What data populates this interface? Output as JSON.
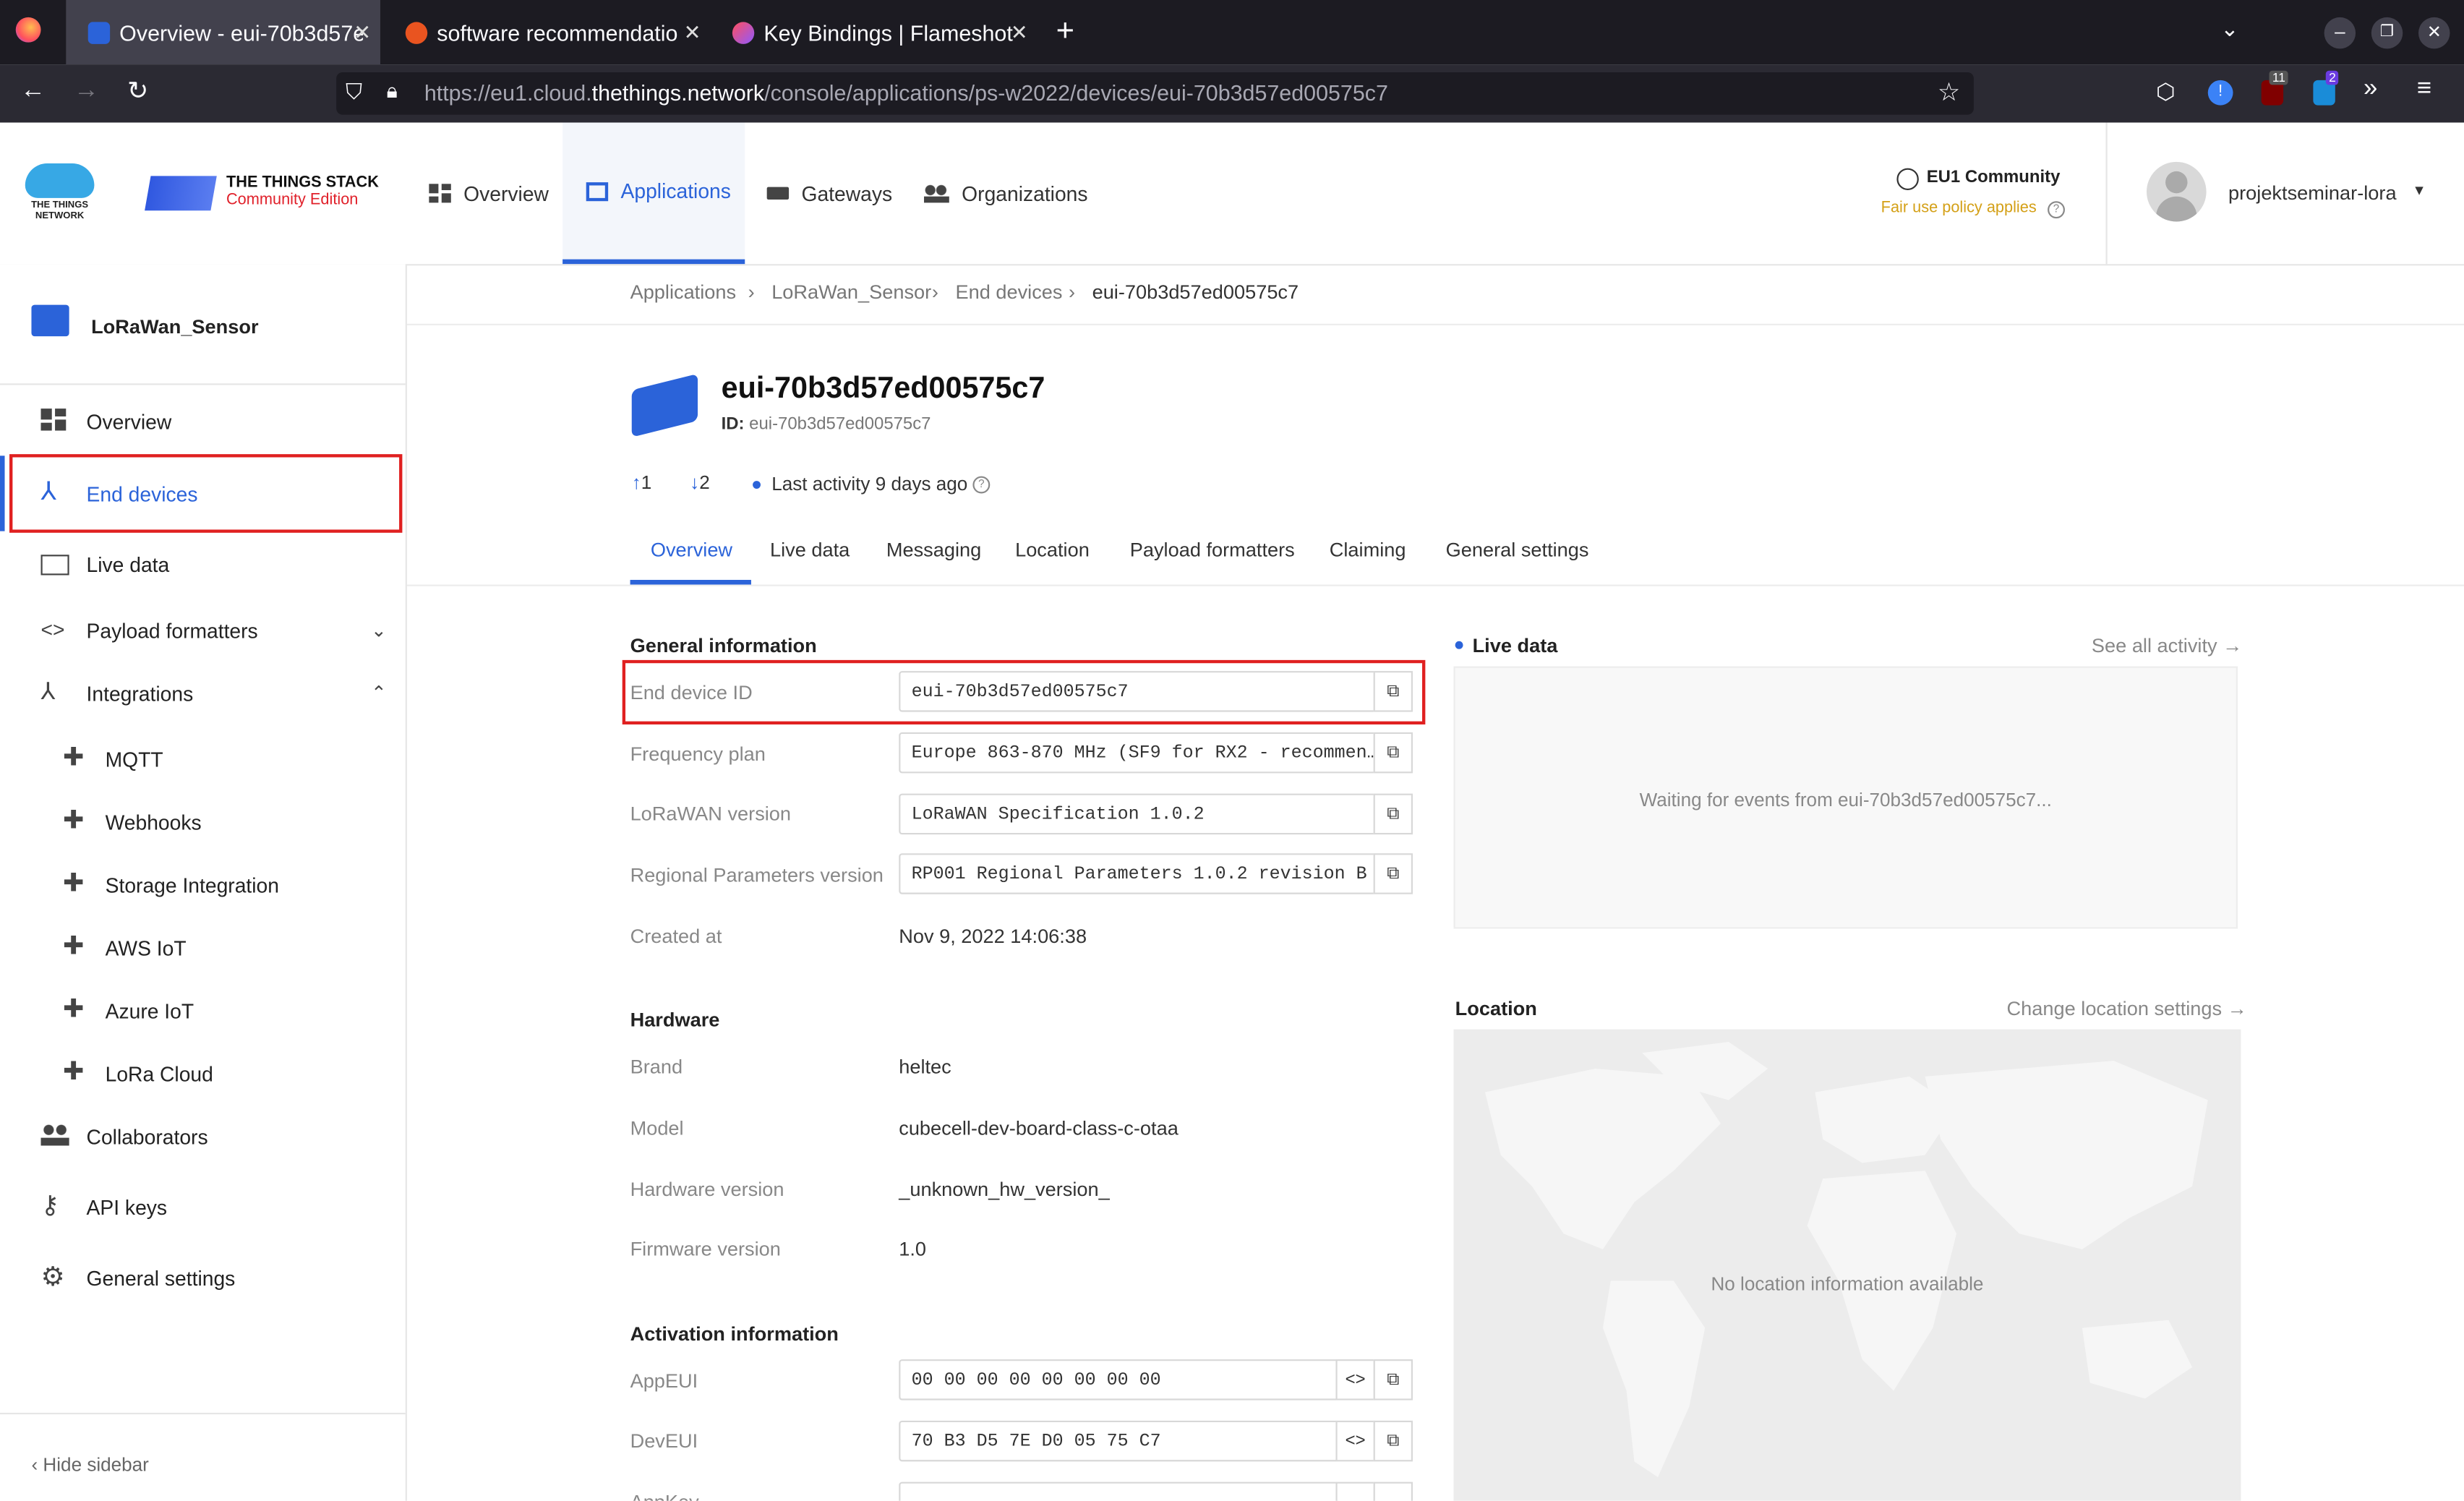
{
  "browser": {
    "tabs": [
      {
        "label": "Overview - eui-70b3d57e"
      },
      {
        "label": "software recommendatio"
      },
      {
        "label": "Key Bindings | Flameshot"
      }
    ],
    "url": {
      "prefix": "https://eu1.cloud.",
      "domain": "thethings.network",
      "path": "/console/applications/ps-w2022/devices/eui-70b3d57ed00575c7"
    },
    "badges": {
      "ublock": "11",
      "ext": "2"
    }
  },
  "header": {
    "ttn_logo": "THE THINGS\nNETWORK",
    "stack_title": "THE THINGS STACK",
    "stack_sub": "Community Edition",
    "nav": [
      {
        "label": "Overview",
        "icon": "dashboard-icon"
      },
      {
        "label": "Applications",
        "icon": "application-icon"
      },
      {
        "label": "Gateways",
        "icon": "gateway-icon"
      },
      {
        "label": "Organizations",
        "icon": "organization-icon"
      }
    ],
    "cluster": "EU1 Community",
    "fair_use": "Fair use policy applies",
    "user": "projektseminar-lora"
  },
  "sidebar": {
    "app_name": "LoRaWan_Sensor",
    "items": [
      {
        "label": "Overview"
      },
      {
        "label": "End devices"
      },
      {
        "label": "Live data"
      },
      {
        "label": "Payload formatters"
      },
      {
        "label": "Integrations"
      }
    ],
    "integrations": [
      "MQTT",
      "Webhooks",
      "Storage Integration",
      "AWS IoT",
      "Azure IoT",
      "LoRa Cloud"
    ],
    "bottom_items": [
      {
        "label": "Collaborators"
      },
      {
        "label": "API keys"
      },
      {
        "label": "General settings"
      }
    ],
    "hide": "Hide sidebar"
  },
  "breadcrumb": [
    "Applications",
    "LoRaWan_Sensor",
    "End devices",
    "eui-70b3d57ed00575c7"
  ],
  "device": {
    "title": "eui-70b3d57ed00575c7",
    "id_label": "ID:",
    "id": "eui-70b3d57ed00575c7",
    "uplink": "1",
    "downlink": "2",
    "last_activity": "Last activity 9 days ago"
  },
  "tabs": [
    "Overview",
    "Live data",
    "Messaging",
    "Location",
    "Payload formatters",
    "Claiming",
    "General settings"
  ],
  "general": {
    "title": "General information",
    "rows": [
      {
        "label": "End device ID",
        "value": "eui-70b3d57ed00575c7"
      },
      {
        "label": "Frequency plan",
        "value": "Europe 863-870 MHz (SF9 for RX2 - recommen…"
      },
      {
        "label": "LoRaWAN version",
        "value": "LoRaWAN Specification 1.0.2"
      },
      {
        "label": "Regional Parameters version",
        "value": "RP001 Regional Parameters 1.0.2 revision B"
      }
    ],
    "created_label": "Created at",
    "created_value": "Nov 9, 2022 14:06:38"
  },
  "hardware": {
    "title": "Hardware",
    "rows": [
      {
        "label": "Brand",
        "value": "heltec"
      },
      {
        "label": "Model",
        "value": "cubecell-dev-board-class-c-otaa"
      },
      {
        "label": "Hardware version",
        "value": "_unknown_hw_version_"
      },
      {
        "label": "Firmware version",
        "value": "1.0"
      }
    ]
  },
  "activation": {
    "title": "Activation information",
    "rows": [
      {
        "label": "AppEUI",
        "value": "00 00 00 00 00 00 00 00"
      },
      {
        "label": "DevEUI",
        "value": "70 B3 D5 7E D0 05 75 C7"
      },
      {
        "label": "AppKey",
        "value": ""
      }
    ]
  },
  "livedata": {
    "title": "Live data",
    "see_all": "See all activity →",
    "waiting": "Waiting for events from eui-70b3d57ed00575c7..."
  },
  "location": {
    "title": "Location",
    "change": "Change location settings →",
    "none": "No location information available"
  }
}
